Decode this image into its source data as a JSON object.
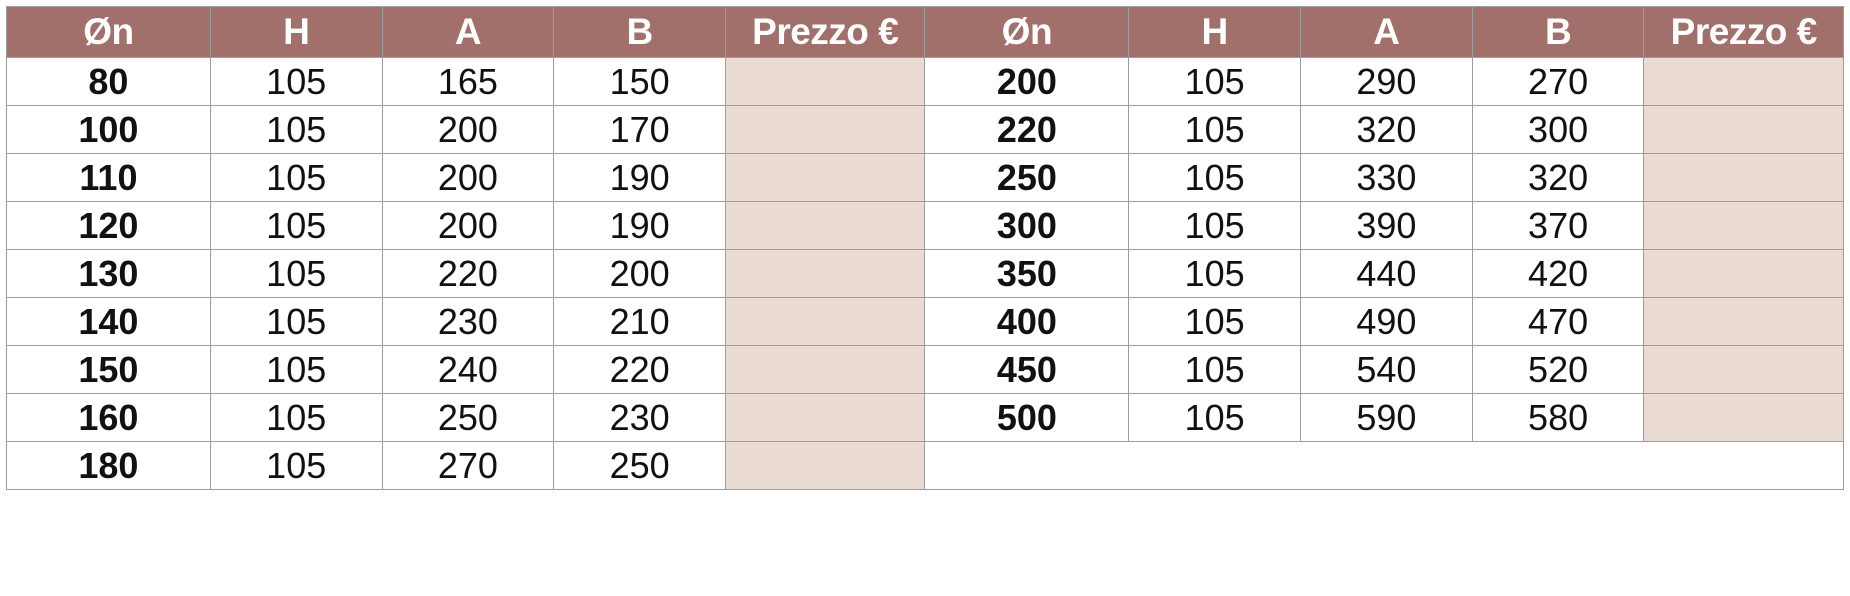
{
  "table": {
    "headers_left": [
      "Øn",
      "H",
      "A",
      "B",
      "Prezzo €"
    ],
    "headers_right": [
      "Øn",
      "H",
      "A",
      "B",
      "Prezzo €"
    ],
    "colors": {
      "header_background": "#a1706a",
      "header_text": "#ffffff",
      "price_cell_fill": "#e9dad2",
      "grid_line": "#9d9d9d",
      "body_text": "#111111",
      "page_background": "#ffffff"
    },
    "rows": [
      {
        "left": {
          "on": "80",
          "h": "105",
          "a": "165",
          "b": "150",
          "prezzo": ""
        },
        "right": {
          "on": "200",
          "h": "105",
          "a": "290",
          "b": "270",
          "prezzo": ""
        }
      },
      {
        "left": {
          "on": "100",
          "h": "105",
          "a": "200",
          "b": "170",
          "prezzo": ""
        },
        "right": {
          "on": "220",
          "h": "105",
          "a": "320",
          "b": "300",
          "prezzo": ""
        }
      },
      {
        "left": {
          "on": "110",
          "h": "105",
          "a": "200",
          "b": "190",
          "prezzo": ""
        },
        "right": {
          "on": "250",
          "h": "105",
          "a": "330",
          "b": "320",
          "prezzo": ""
        }
      },
      {
        "left": {
          "on": "120",
          "h": "105",
          "a": "200",
          "b": "190",
          "prezzo": ""
        },
        "right": {
          "on": "300",
          "h": "105",
          "a": "390",
          "b": "370",
          "prezzo": ""
        }
      },
      {
        "left": {
          "on": "130",
          "h": "105",
          "a": "220",
          "b": "200",
          "prezzo": ""
        },
        "right": {
          "on": "350",
          "h": "105",
          "a": "440",
          "b": "420",
          "prezzo": ""
        }
      },
      {
        "left": {
          "on": "140",
          "h": "105",
          "a": "230",
          "b": "210",
          "prezzo": ""
        },
        "right": {
          "on": "400",
          "h": "105",
          "a": "490",
          "b": "470",
          "prezzo": ""
        }
      },
      {
        "left": {
          "on": "150",
          "h": "105",
          "a": "240",
          "b": "220",
          "prezzo": ""
        },
        "right": {
          "on": "450",
          "h": "105",
          "a": "540",
          "b": "520",
          "prezzo": ""
        }
      },
      {
        "left": {
          "on": "160",
          "h": "105",
          "a": "250",
          "b": "230",
          "prezzo": ""
        },
        "right": {
          "on": "500",
          "h": "105",
          "a": "590",
          "b": "580",
          "prezzo": ""
        }
      },
      {
        "left": {
          "on": "180",
          "h": "105",
          "a": "270",
          "b": "250",
          "prezzo": ""
        },
        "right": null
      }
    ]
  }
}
